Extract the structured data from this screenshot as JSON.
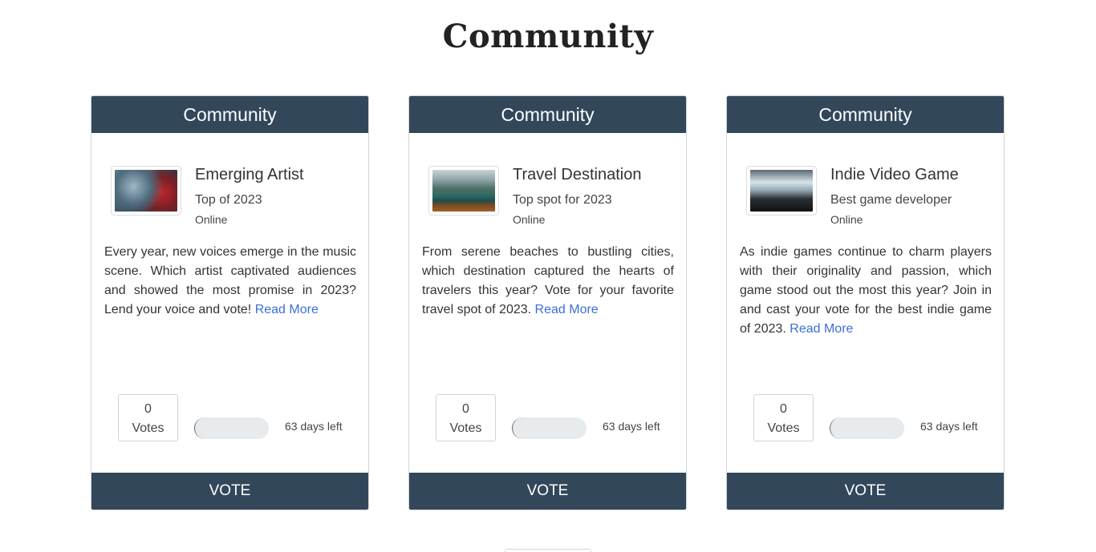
{
  "page": {
    "title": "Community"
  },
  "cards": [
    {
      "header": "Community",
      "title": "Emerging Artist",
      "subtitle": "Top of 2023",
      "status": "Online",
      "image": "concert-artist-photo",
      "description": "Every year, new voices emerge in the music scene. Which artist captivated audiences and showed the most promise in 2023? Lend your voice and vote!",
      "read_more": "Read More",
      "votes_count": "0",
      "votes_label": "Votes",
      "progress": 0,
      "days_left": "63 days left",
      "vote_label": "VOTE"
    },
    {
      "header": "Community",
      "title": "Travel Destination",
      "subtitle": "Top spot for 2023",
      "status": "Online",
      "image": "lake-boat-photo",
      "description": "From serene beaches to bustling cities, which destination captured the hearts of travelers this year? Vote for your favorite travel spot of 2023.",
      "read_more": "Read More",
      "votes_count": "0",
      "votes_label": "Votes",
      "progress": 0,
      "days_left": "63 days left",
      "vote_label": "VOTE"
    },
    {
      "header": "Community",
      "title": "Indie Video Game",
      "subtitle": "Best game developer",
      "status": "Online",
      "image": "gaming-controller-photo",
      "description": "As indie games continue to charm players with their originality and passion, which game stood out the most this year? Join in and cast your vote for the best indie game of 2023.",
      "read_more": "Read More",
      "votes_count": "0",
      "votes_label": "Votes",
      "progress": 0,
      "days_left": "63 days left",
      "vote_label": "VOTE"
    }
  ],
  "colors": {
    "header_bg": "#33475b",
    "link": "#3b6fd6",
    "progress_track": "#e8ebed"
  }
}
